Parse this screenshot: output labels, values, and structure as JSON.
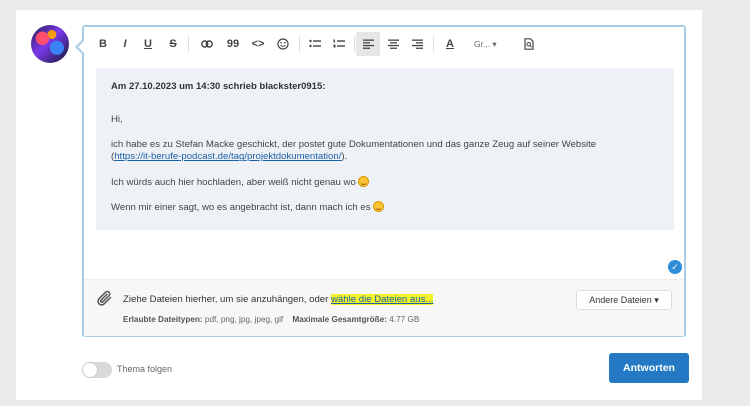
{
  "toolbar": {
    "bold": "B",
    "italic": "I",
    "underline": "U",
    "strike": "S",
    "quote": "99",
    "code": "<>",
    "heading": "A",
    "size": "Gr... ▾"
  },
  "quote": {
    "header": "Am 27.10.2023 um 14:30 schrieb blackster0915:",
    "greeting": "Hi,",
    "line1": "ich habe es zu Stefan Macke geschickt, der postet gute Dokumentationen und das ganze Zeug auf seiner Website",
    "link_open": "(",
    "link": "https://it-berufe-podcast.de/tag/projektdokumentation/",
    "link_close": ").",
    "line2": "Ich würds auch hier hochladen, aber weiß nicht genau wo",
    "line3": "Wenn mir einer sagt, wo es angebracht ist, dann mach ich es"
  },
  "attach": {
    "text": "Ziehe Dateien hierher, um sie anzuhängen, oder ",
    "choose": "wähle die Dateien aus...",
    "types_label": "Erlaubte Dateitypen:",
    "types": "pdf, png, jpg, jpeg, gif",
    "max_label": "Maximale Gesamtgröße:",
    "max": "4.77 GB",
    "other_button": "Andere Dateien ▾"
  },
  "footer": {
    "follow": "Thema folgen",
    "reply": "Antworten"
  }
}
